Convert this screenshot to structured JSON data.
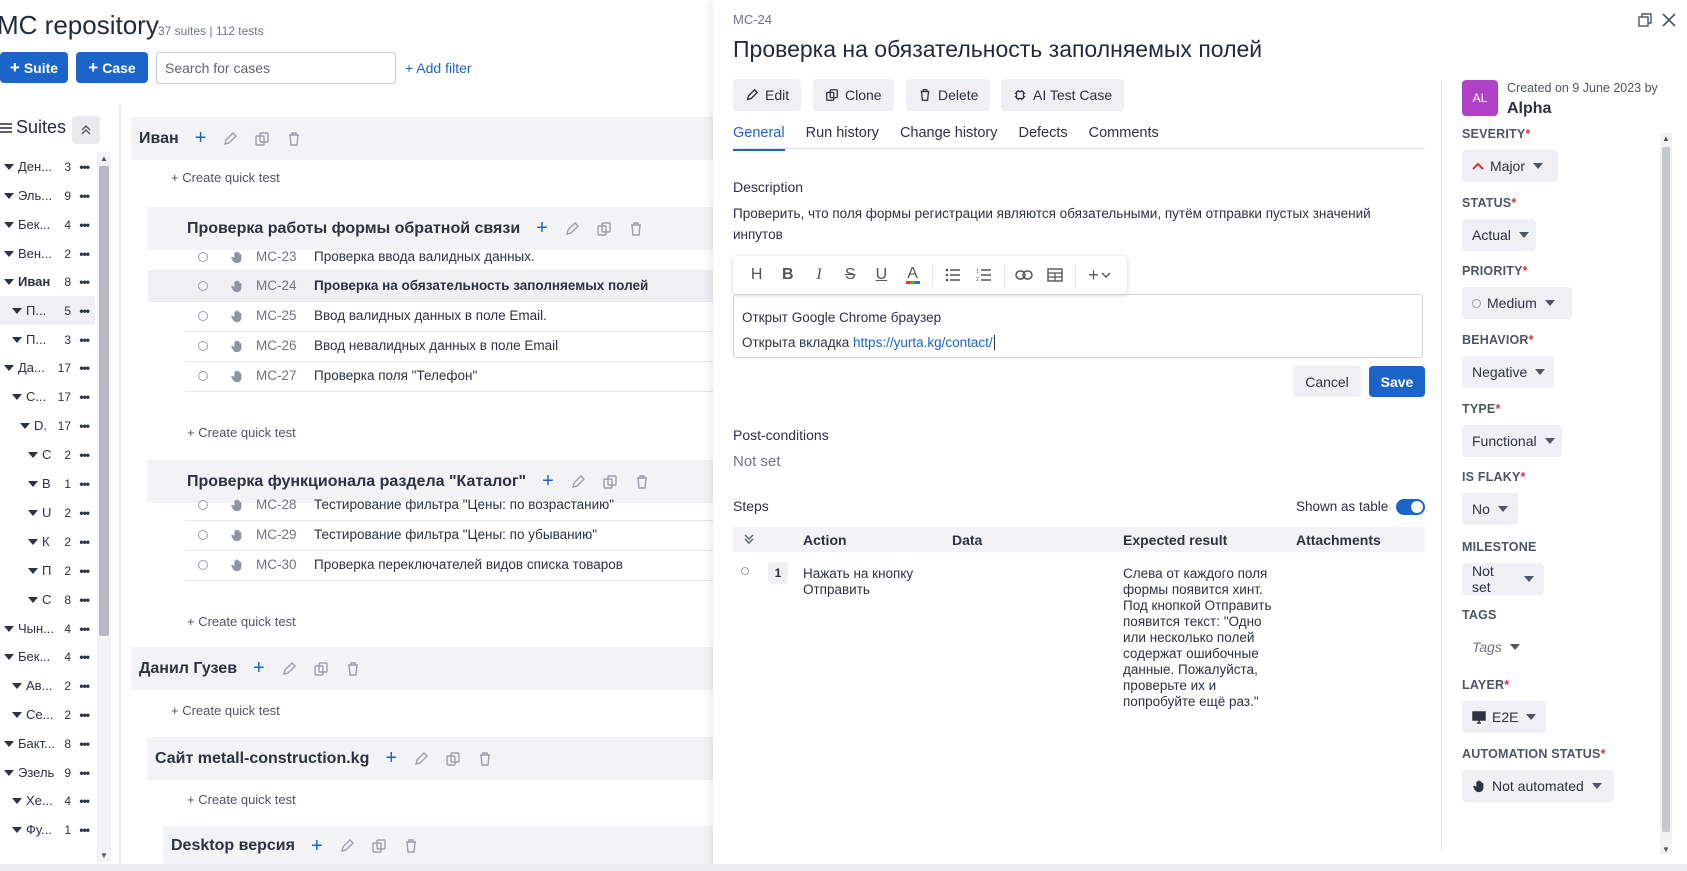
{
  "repo": {
    "title": "MC repository",
    "meta": "37 suites | 112 tests",
    "suite_btn": "Suite",
    "case_btn": "Case",
    "search_placeholder": "Search for cases",
    "add_filter": "+ Add filter",
    "suites_heading": "Suites"
  },
  "tree": [
    {
      "label": "Ден...",
      "count": "3"
    },
    {
      "label": "Эль...",
      "count": "9"
    },
    {
      "label": "Бек...",
      "count": "4"
    },
    {
      "label": "Вен...",
      "count": "2"
    },
    {
      "label": "Иван",
      "count": "8"
    },
    {
      "label": "П...",
      "count": "5"
    },
    {
      "label": "П...",
      "count": "3"
    },
    {
      "label": "Да...",
      "count": "17"
    },
    {
      "label": "С...",
      "count": "17"
    },
    {
      "label": "D.",
      "count": "17"
    },
    {
      "label": "С",
      "count": "2"
    },
    {
      "label": "В",
      "count": "1"
    },
    {
      "label": "U",
      "count": "2"
    },
    {
      "label": "К",
      "count": "2"
    },
    {
      "label": "П",
      "count": "2"
    },
    {
      "label": "С",
      "count": "8"
    },
    {
      "label": "Чын...",
      "count": "4"
    },
    {
      "label": "Бек...",
      "count": "4"
    },
    {
      "label": "Ав...",
      "count": "2"
    },
    {
      "label": "Се...",
      "count": "2"
    },
    {
      "label": "Бакт...",
      "count": "8"
    },
    {
      "label": "Эзель",
      "count": "9"
    },
    {
      "label": "Хе...",
      "count": "4"
    },
    {
      "label": "Фу...",
      "count": "1"
    }
  ],
  "suites": {
    "ivan": "Иван",
    "form": "Проверка работы формы обратной связи",
    "catalog": "Проверка функционала раздела \"Каталог\"",
    "danil": "Данил Гузев",
    "metall": "Сайт metall-construction.kg",
    "desktop": "Desktop версия",
    "quick_test": "+ Create quick test"
  },
  "cases": [
    {
      "id": "MC-23",
      "title": "Проверка ввода валидных данных."
    },
    {
      "id": "MC-24",
      "title": "Проверка на обязательность заполняемых полей"
    },
    {
      "id": "MC-25",
      "title": "Ввод валидных данных в поле Email."
    },
    {
      "id": "MC-26",
      "title": "Ввод невалидных данных в поле Email"
    },
    {
      "id": "MC-27",
      "title": "Проверка поля \"Телефон\""
    },
    {
      "id": "MC-28",
      "title": "Тестирование фильтра \"Цены: по возрастанию\""
    },
    {
      "id": "MC-29",
      "title": "Тестирование фильтра \"Цены: по убыванию\""
    },
    {
      "id": "MC-30",
      "title": "Проверка переключателей видов списка товаров"
    }
  ],
  "detail": {
    "id": "MC-24",
    "title": "Проверка на обязательность заполняемых полей",
    "buttons": {
      "edit": "Edit",
      "clone": "Clone",
      "delete": "Delete",
      "ai": "AI Test Case"
    },
    "tabs": [
      "General",
      "Run history",
      "Change history",
      "Defects",
      "Comments"
    ],
    "description_label": "Description",
    "description": "Проверить, что поля формы регистрации являются обязательными, путём отправки пустых значений инпутов",
    "editor_line1": "Открыт Google Chrome браузер",
    "editor_line2_prefix": "Открыта вкладка ",
    "editor_link": "https://yurta.kg/contact/",
    "cancel": "Cancel",
    "save": "Save",
    "post_label": "Post-conditions",
    "post_value": "Not set",
    "steps_label": "Steps",
    "shown_as_table": "Shown as table",
    "step_cols": [
      "Action",
      "Data",
      "Expected result",
      "Attachments"
    ],
    "step": {
      "num": "1",
      "action": "Нажать на кнопку Отправить",
      "expected": "Слева от каждого поля формы появится хинт. Под кнопкой Отправить появится текст: \"Одно или несколько полей содержат ошибочные данные. Пожалуйста, проверьте их и попробуйте ещё раз.\""
    }
  },
  "sidebar": {
    "avatar": "AL",
    "created": "Created on 9 June 2023 by",
    "creator": "Alpha",
    "fields": [
      {
        "label": "SEVERITY",
        "required": true,
        "value": "Major"
      },
      {
        "label": "STATUS",
        "required": true,
        "value": "Actual"
      },
      {
        "label": "PRIORITY",
        "required": true,
        "value": "Medium"
      },
      {
        "label": "BEHAVIOR",
        "required": true,
        "value": "Negative"
      },
      {
        "label": "TYPE",
        "required": true,
        "value": "Functional"
      },
      {
        "label": "IS FLAKY",
        "required": true,
        "value": "No"
      },
      {
        "label": "MILESTONE",
        "required": false,
        "value": "Not set"
      },
      {
        "label": "TAGS",
        "required": false,
        "value": "Tags"
      },
      {
        "label": "LAYER",
        "required": true,
        "value": "E2E"
      },
      {
        "label": "AUTOMATION STATUS",
        "required": true,
        "value": "Not automated"
      }
    ]
  },
  "colors": {
    "accent": "#1b64c9",
    "avatar": "#b040c5",
    "required": "#d0343a",
    "severity": "#d0343a"
  }
}
